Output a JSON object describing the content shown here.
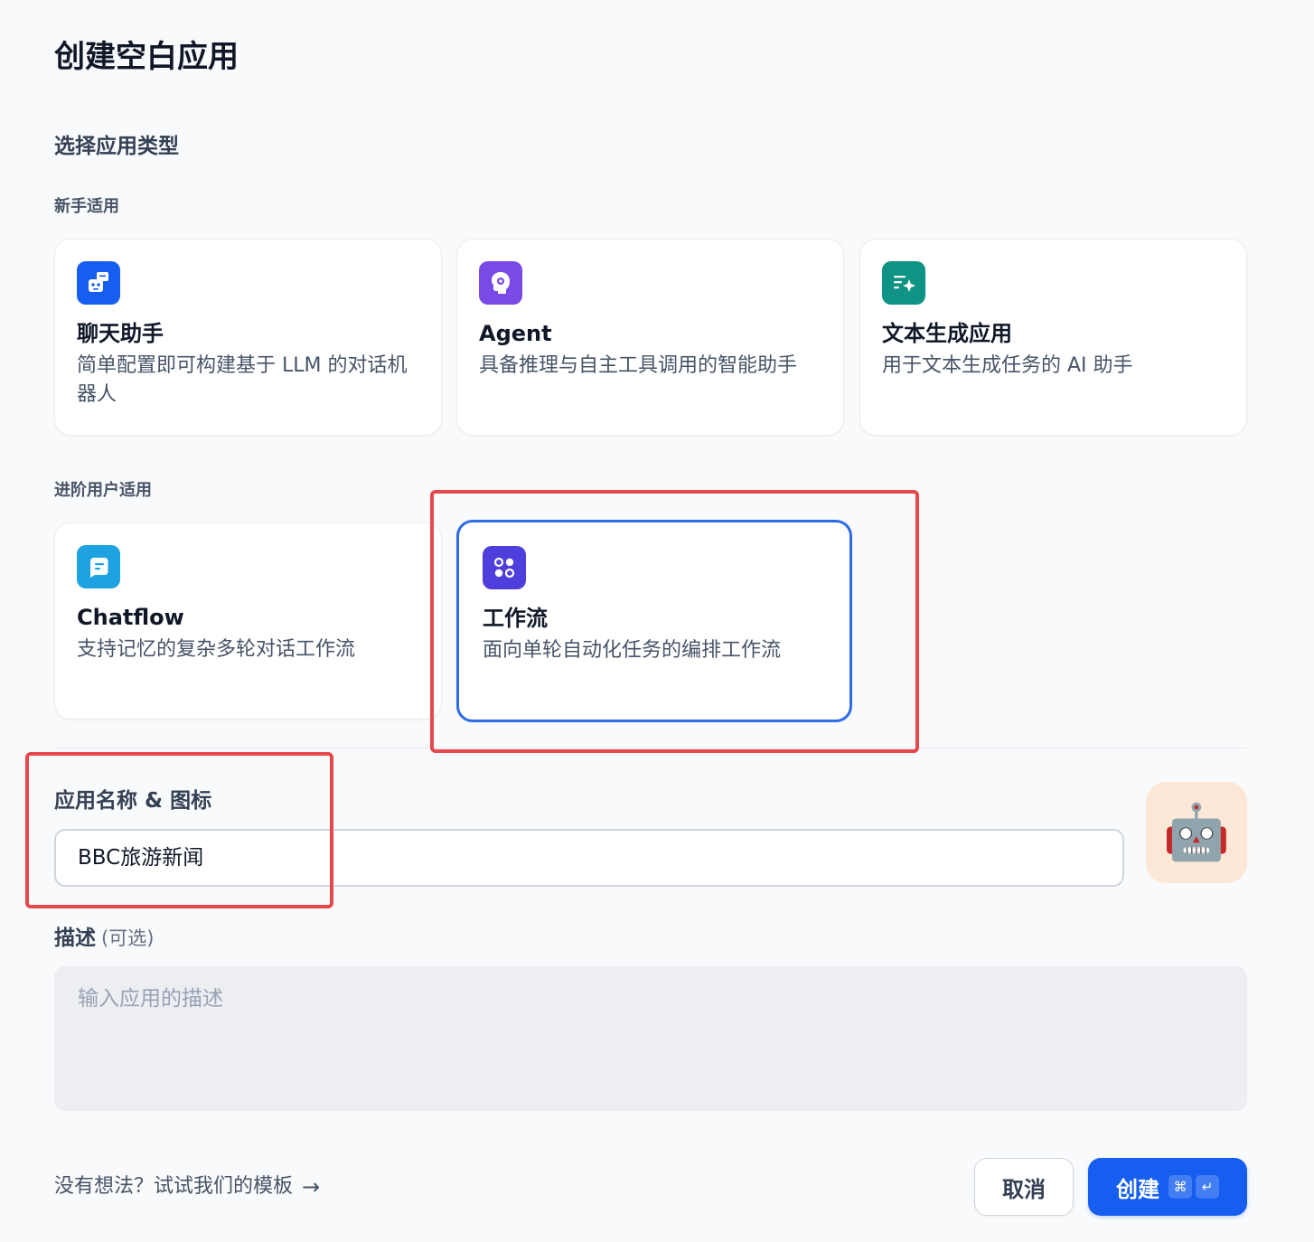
{
  "page": {
    "title": "创建空白应用",
    "section_title": "选择应用类型"
  },
  "groups": {
    "beginner": "新手适用",
    "advanced": "进阶用户适用"
  },
  "app_types": {
    "chat": {
      "title": "聊天助手",
      "desc": "简单配置即可构建基于 LLM 的对话机器人",
      "icon": "chat-bot-icon",
      "color": "#155eef"
    },
    "agent": {
      "title": "Agent",
      "desc": "具备推理与自主工具调用的智能助手",
      "icon": "agent-brain-icon",
      "color": "#7a4ae6"
    },
    "text": {
      "title": "文本生成应用",
      "desc": "用于文本生成任务的 AI 助手",
      "icon": "text-generation-icon",
      "color": "#0e9384"
    },
    "chatflow": {
      "title": "Chatflow",
      "desc": "支持记忆的复杂多轮对话工作流",
      "icon": "chatflow-icon",
      "color": "#1ea3e0"
    },
    "workflow": {
      "title": "工作流",
      "desc": "面向单轮自动化任务的编排工作流",
      "icon": "workflow-icon",
      "color": "#4e3fdc",
      "selected": true
    }
  },
  "form": {
    "name_label": "应用名称 & 图标",
    "name_value": "BBC旅游新闻",
    "avatar_emoji": "🤖",
    "avatar_bg": "#fde8d7",
    "desc_label": "描述",
    "desc_optional": "(可选)",
    "desc_placeholder": "输入应用的描述"
  },
  "footer": {
    "template_link": "没有想法？试试我们的模板",
    "template_arrow": "→",
    "cancel_label": "取消",
    "create_label": "创建",
    "kbd_cmd": "⌘",
    "kbd_enter": "↵"
  },
  "colors": {
    "accent": "#155eef",
    "selected_border": "#2e6ce6",
    "annotation": "#e5484d"
  }
}
